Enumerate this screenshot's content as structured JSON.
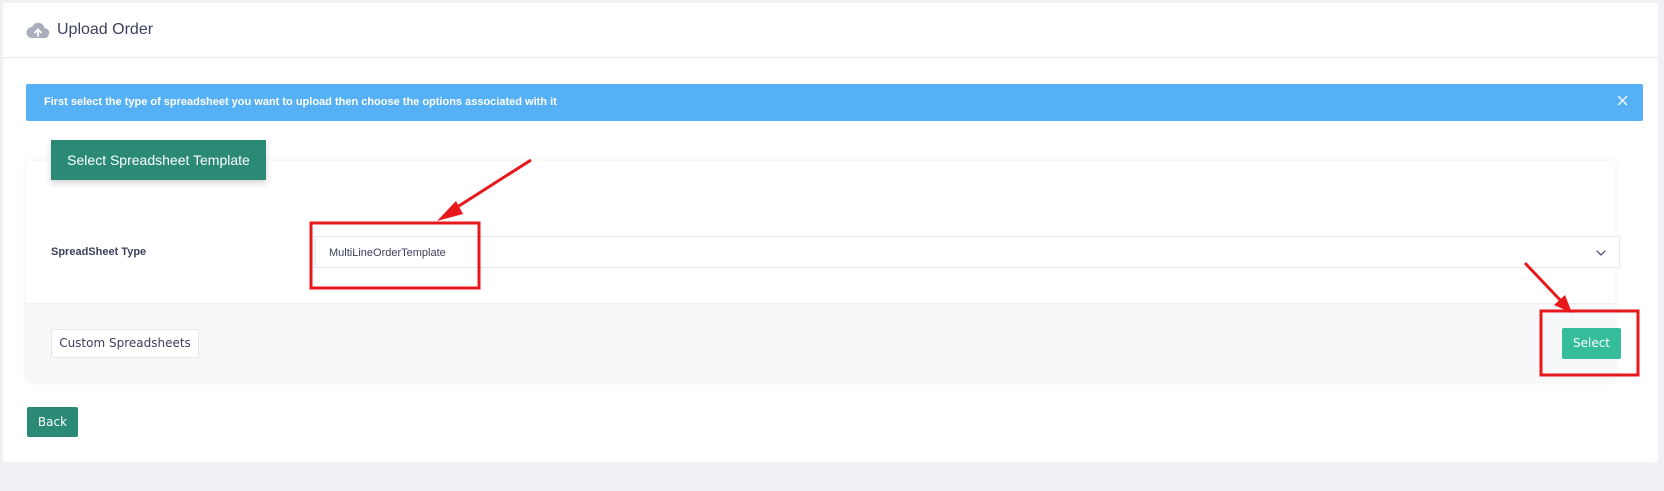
{
  "header": {
    "title": "Upload Order",
    "icon": "cloud-upload-icon"
  },
  "alert": {
    "message": "First select the type of spreadsheet you want to upload then choose the options associated with it",
    "close_symbol": "×",
    "color": "#56b0f5"
  },
  "card": {
    "badge_label": "Select Spreadsheet Template",
    "field_label": "SpreadSheet Type",
    "select_value": "MultiLineOrderTemplate"
  },
  "footer": {
    "custom_label": "Custom Spreadsheets",
    "select_label": "Select"
  },
  "back_label": "Back",
  "colors": {
    "primary": "#2a8a76",
    "select_button": "#34bc9b",
    "annotation": "#e8171b"
  }
}
